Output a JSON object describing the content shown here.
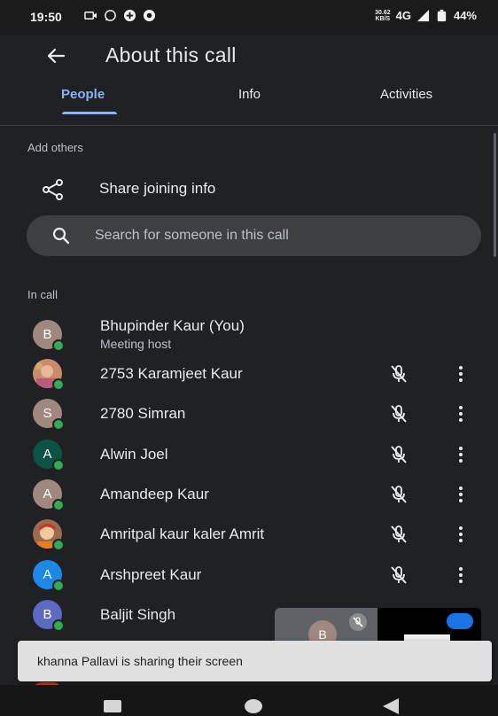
{
  "status_bar": {
    "time": "19:50",
    "speed_value": "30.62",
    "speed_unit": "KB/S",
    "network": "4G",
    "battery": "44%"
  },
  "header": {
    "back_icon": "arrow-left-icon",
    "title": "About this call"
  },
  "tabs": [
    {
      "label": "People",
      "active": true
    },
    {
      "label": "Info",
      "active": false
    },
    {
      "label": "Activities",
      "active": false
    }
  ],
  "add_others": {
    "section_label": "Add others",
    "share_label": "Share joining info",
    "share_icon": "share-icon"
  },
  "search": {
    "placeholder": "Search for someone in this call",
    "icon": "search-icon"
  },
  "in_call": {
    "section_label": "In call",
    "participants": [
      {
        "name": "Bhupinder Kaur (You)",
        "subtitle": "Meeting host",
        "initial": "B",
        "avatar_color": "#a1887f",
        "photo": false,
        "muted_icon": false
      },
      {
        "name": "2753 Karamjeet Kaur",
        "initial": "",
        "avatar_color": "#b07a5a",
        "photo": true,
        "muted_icon": true
      },
      {
        "name": "2780 Simran",
        "initial": "S",
        "avatar_color": "#a1887f",
        "photo": false,
        "muted_icon": true
      },
      {
        "name": "Alwin Joel",
        "initial": "A",
        "avatar_color": "#0b5345",
        "photo": false,
        "muted_icon": true
      },
      {
        "name": "Amandeep Kaur",
        "initial": "A",
        "avatar_color": "#a1887f",
        "photo": false,
        "muted_icon": true
      },
      {
        "name": "Amritpal kaur kaler Amrit",
        "initial": "",
        "avatar_color": "#8d6e63",
        "photo": true,
        "muted_icon": true
      },
      {
        "name": "Arshpreet Kaur",
        "initial": "A",
        "avatar_color": "#1e88e5",
        "photo": false,
        "muted_icon": true
      },
      {
        "name": "Baljit Singh",
        "initial": "B",
        "avatar_color": "#5c6bc0",
        "photo": false,
        "muted_icon": false
      }
    ]
  },
  "pip": {
    "avatar_initial": "B"
  },
  "snackbar": {
    "text": "khanna Pallavi is sharing their screen"
  },
  "colors": {
    "accent": "#8ab4f8",
    "background": "#202124",
    "online": "#34a853"
  }
}
